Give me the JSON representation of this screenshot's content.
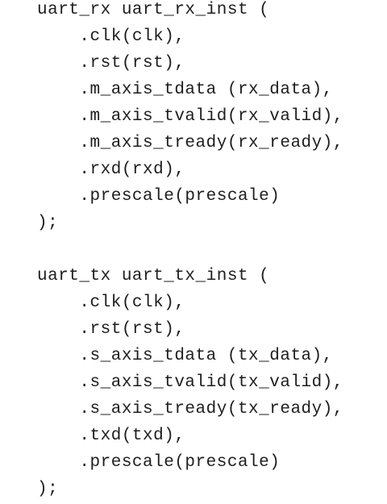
{
  "code": {
    "lines": [
      "uart_rx uart_rx_inst (",
      "    .clk(clk),",
      "    .rst(rst),",
      "    .m_axis_tdata (rx_data),",
      "    .m_axis_tvalid(rx_valid),",
      "    .m_axis_tready(rx_ready),",
      "    .rxd(rxd),",
      "    .prescale(prescale)",
      ");",
      "",
      "uart_tx uart_tx_inst (",
      "    .clk(clk),",
      "    .rst(rst),",
      "    .s_axis_tdata (tx_data),",
      "    .s_axis_tvalid(tx_valid),",
      "    .s_axis_tready(tx_ready),",
      "    .txd(txd),",
      "    .prescale(prescale)",
      ");"
    ]
  }
}
